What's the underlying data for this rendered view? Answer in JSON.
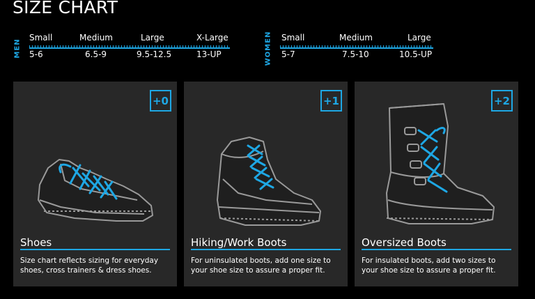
{
  "page": {
    "title": "SIZE CHART"
  },
  "men": {
    "label": "MEN",
    "sizes": [
      {
        "name": "Small",
        "range": "5-6"
      },
      {
        "name": "Medium",
        "range": "6.5-9"
      },
      {
        "name": "Large",
        "range": "9.5-12.5"
      },
      {
        "name": "X-Large",
        "range": "13-UP"
      }
    ]
  },
  "women": {
    "label": "WOMEN",
    "sizes": [
      {
        "name": "Small",
        "range": "5-7"
      },
      {
        "name": "Medium",
        "range": "7.5-10"
      },
      {
        "name": "Large",
        "range": "10.5-UP"
      }
    ]
  },
  "cards": [
    {
      "badge": "+0",
      "title": "Shoes",
      "description": "Size chart reflects sizing for everyday shoes, cross trainers & dress shoes.",
      "icon": "shoe-icon"
    },
    {
      "badge": "+1",
      "title": "Hiking/Work Boots",
      "description": "For uninsulated boots, add one size to your shoe size to assure a proper fit.",
      "icon": "hiking-boot-icon"
    },
    {
      "badge": "+2",
      "title": "Oversized Boots",
      "description": "For insulated boots, add two sizes to your shoe size to assure a proper fit.",
      "icon": "winter-boot-icon"
    }
  ],
  "colors": {
    "background": "#000000",
    "card": "#282828",
    "accent": "#1ea7e4",
    "text": "#ffffff"
  }
}
